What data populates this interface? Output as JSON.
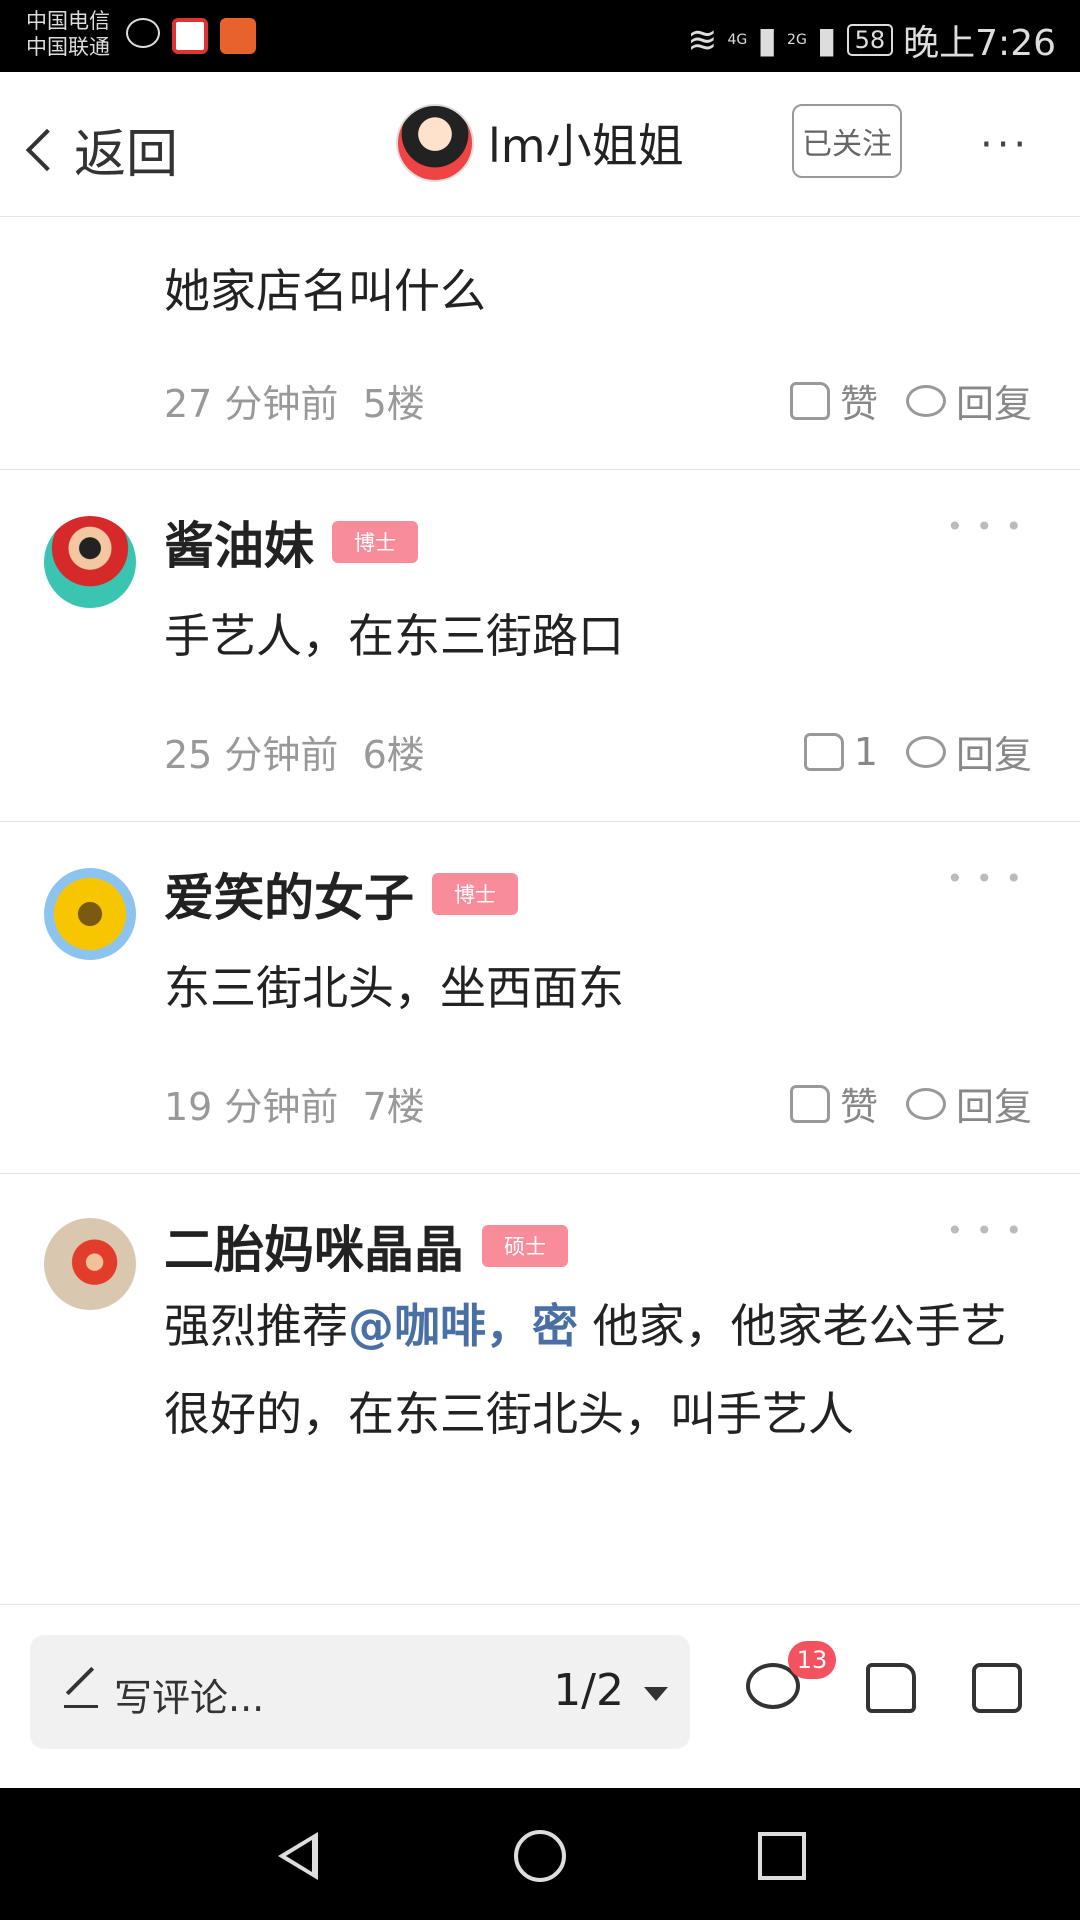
{
  "status_bar": {
    "carrier_1": "中国电信",
    "carrier_2": "中国联通",
    "signal_1": "4G",
    "signal_2": "2G",
    "battery": "58",
    "time": "晚上7:26"
  },
  "header": {
    "back_label": "返回",
    "title": "lm小姐姐",
    "follow_label": "已关注",
    "more_label": "···"
  },
  "comments": [
    {
      "text": "她家店名叫什么",
      "time": "27 分钟前",
      "floor": "5楼",
      "like_label": "赞",
      "reply_label": "回复"
    },
    {
      "name": "酱油妹",
      "badge": "博士",
      "text": "手艺人，在东三街路口",
      "time": "25 分钟前",
      "floor": "6楼",
      "like_label": "1",
      "reply_label": "回复"
    },
    {
      "name": "爱笑的女子",
      "badge": "博士",
      "text": "东三街北头，坐西面东",
      "time": "19 分钟前",
      "floor": "7楼",
      "like_label": "赞",
      "reply_label": "回复"
    },
    {
      "name": "二胎妈咪晶晶",
      "badge": "硕士",
      "text_prefix": "强烈推荐",
      "mention": "@咖啡，密",
      "text_suffix": " 他家，他家老公手艺很好的，在东三街北头，叫手艺人"
    }
  ],
  "bottom_bar": {
    "composer_placeholder": "写评论...",
    "page_indicator": "1/2",
    "comment_count": "13"
  },
  "colors": {
    "badge": "#f98c9a",
    "mention": "#4a6fa5",
    "count_badge": "#f5525f"
  }
}
